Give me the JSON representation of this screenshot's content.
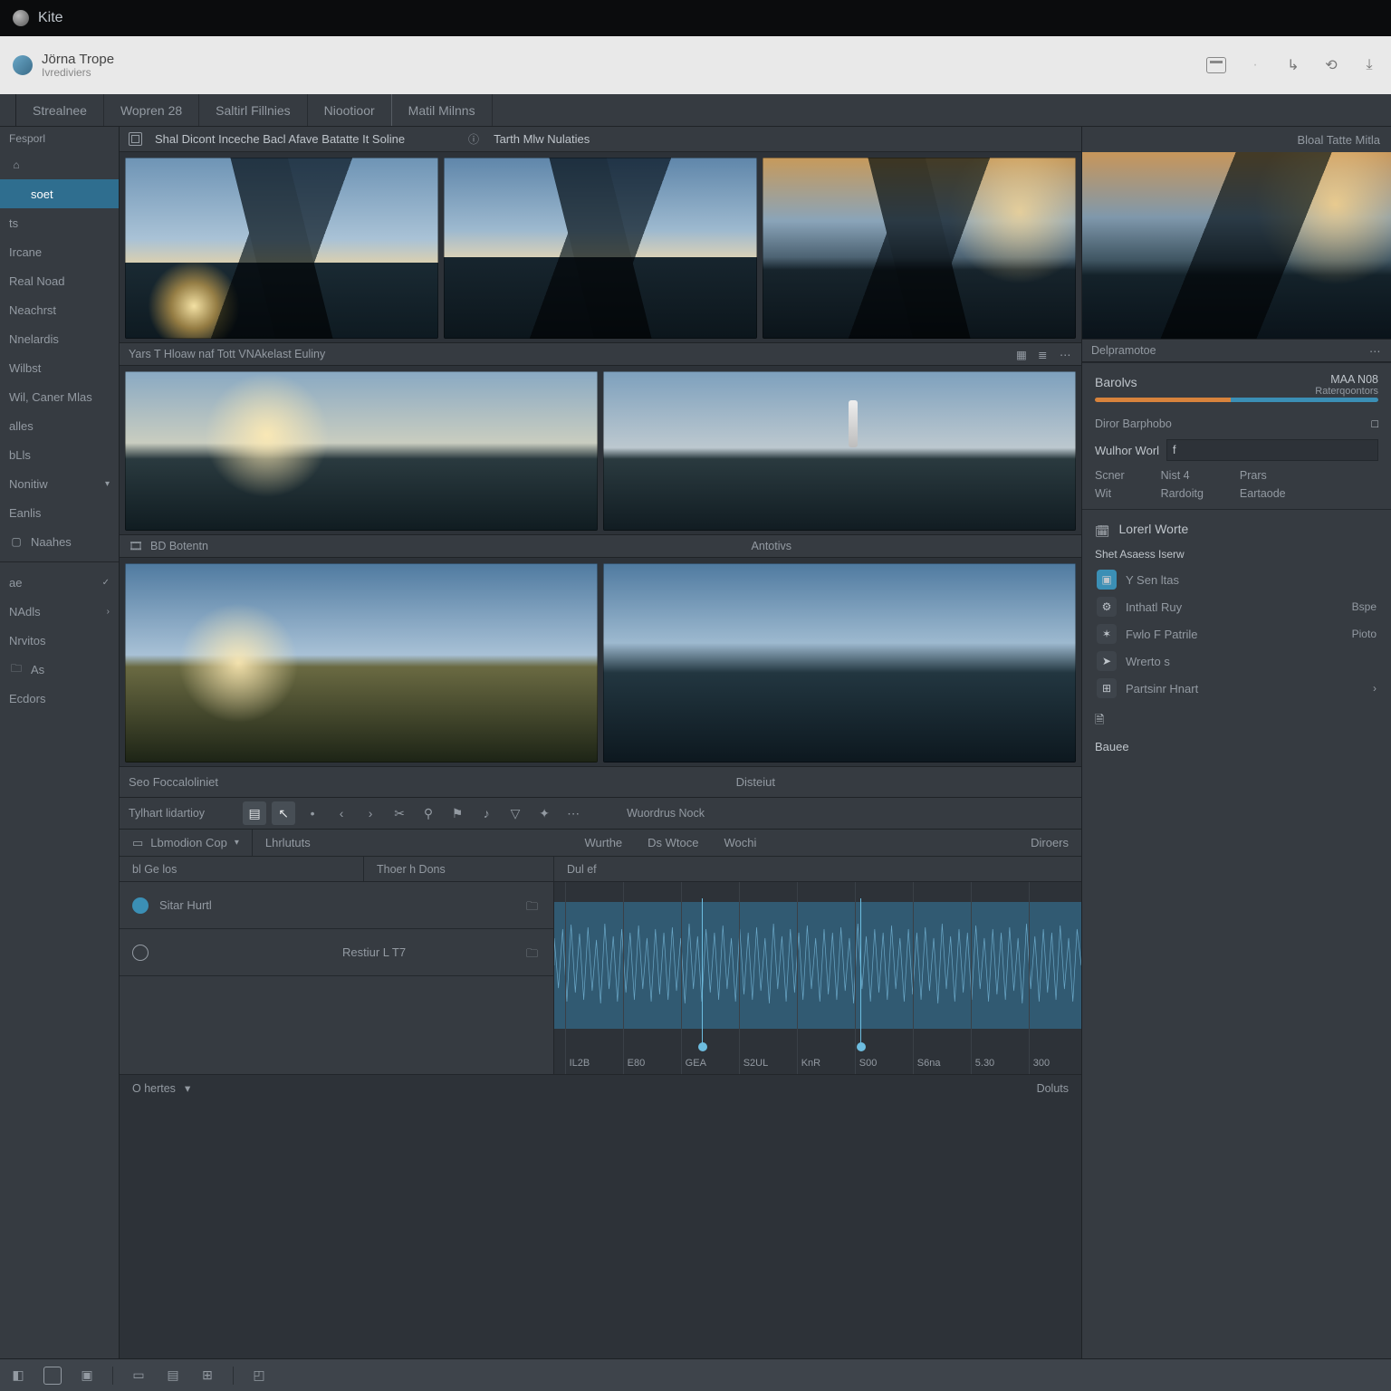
{
  "titlebar": {
    "app_name": "Kite"
  },
  "chrome": {
    "doc_title": "Jörna Trope",
    "doc_sub": "Ivrediviers",
    "sep": "·"
  },
  "menu": {
    "items": [
      "Strealnee",
      "Wopren 28",
      "Saltirl Fillnies",
      "Niootioor",
      "Matil Milnns"
    ]
  },
  "sidebar": {
    "header": "Fesporl",
    "items": [
      {
        "label": "",
        "icon": "home"
      },
      {
        "label": "soet",
        "icon": "",
        "active": true
      },
      {
        "label": "ts",
        "icon": ""
      },
      {
        "label": "Ircane",
        "icon": ""
      },
      {
        "label": "Real Noad",
        "icon": ""
      },
      {
        "label": "Neachrst",
        "icon": ""
      },
      {
        "label": "Nnelardis",
        "icon": ""
      },
      {
        "label": "Wilbst",
        "icon": ""
      },
      {
        "label": "Wil, Caner Mlas",
        "icon": ""
      },
      {
        "label": "alles",
        "icon": ""
      },
      {
        "label": "bLls",
        "icon": ""
      },
      {
        "label": "Nonitiw",
        "icon": "",
        "chev": true
      },
      {
        "label": "Eanlis",
        "icon": ""
      },
      {
        "label": "Naahes",
        "icon": "box"
      }
    ],
    "group2": [
      {
        "label": "ae",
        "icon": ""
      },
      {
        "label": "NAdls",
        "icon": "chev-r"
      },
      {
        "label": "Nrvitos",
        "icon": ""
      },
      {
        "label": "As",
        "icon": "folder"
      },
      {
        "label": "Ecdors",
        "icon": ""
      }
    ]
  },
  "center": {
    "panel1": {
      "title": "Shal Dicont Inceche     Bacl Afave Batatte It Soline",
      "tab2": "Tarth Mlw Nulaties"
    },
    "panel2": {
      "title": "Yars T Hloaw naf Tott VNAkelast Euliny"
    },
    "panel3": {
      "title_left": "BD Botentn",
      "title_right": "Antotivs"
    },
    "footer": {
      "left": "Seo Foccaloliniet",
      "right": "Disteiut"
    }
  },
  "inspector": {
    "top_label": "Bloal Tatte Mitla",
    "row2": {
      "left": "Delpramotoe"
    },
    "section1": {
      "title": "Barolvs",
      "meta_k": "MAA N08",
      "meta_v": "Raterqoontors",
      "bar_label": "Diror Barphobo",
      "field_label": "Wulhor Worl",
      "field_value": "f",
      "cols": {
        "c1a": "Scner",
        "c1b": "Wit",
        "c2a": "Nist 4",
        "c2b": "Rardoitg",
        "c3a": "Prars",
        "c3b": "Eartaode"
      }
    },
    "section2": {
      "title": "Lorerl Worte",
      "sub": "Shet Asaess Iserw",
      "items": [
        {
          "label": "Y Sen ltas",
          "right": ""
        },
        {
          "label": "Inthatl Ruy",
          "right": "Bspe"
        },
        {
          "label": "Fwlo F Patrile",
          "right": "Pioto"
        },
        {
          "label": "Wrerto s",
          "right": ""
        },
        {
          "label": "Partsinr Hnart",
          "right": ""
        }
      ],
      "footer": "Bauee"
    }
  },
  "toolbar": {
    "label_left": "Tylhart lidartioy",
    "mid1": "Wuordrus   Nock",
    "icons": [
      "layers",
      "cursor",
      "back",
      "fwd",
      "cut",
      "pin",
      "audio",
      "marker",
      "flag",
      "filter",
      "wand",
      "more"
    ]
  },
  "timeline": {
    "head": {
      "seg1": "Lbmodion Cop",
      "seg2": "Lhrlututs",
      "seg3": "Wurthe",
      "seg4": "Ds   Wtoce",
      "seg5": "Wochi",
      "right": "Diroers"
    },
    "sub": {
      "c1": "bl Ge los",
      "c2": "Thoer h  Dons",
      "c3": "Dul ef"
    },
    "tracks": [
      {
        "name": "Sitar Hurtl",
        "meta": ""
      },
      {
        "name": "",
        "meta": "Restiur L T7"
      }
    ],
    "ticks": [
      "IL2B",
      "E80",
      "GEA",
      "S2UL",
      "KnR",
      "S00",
      "S6na",
      "5.30",
      "300"
    ],
    "footer": {
      "label": "O hertes",
      "time": "Doluts"
    }
  }
}
